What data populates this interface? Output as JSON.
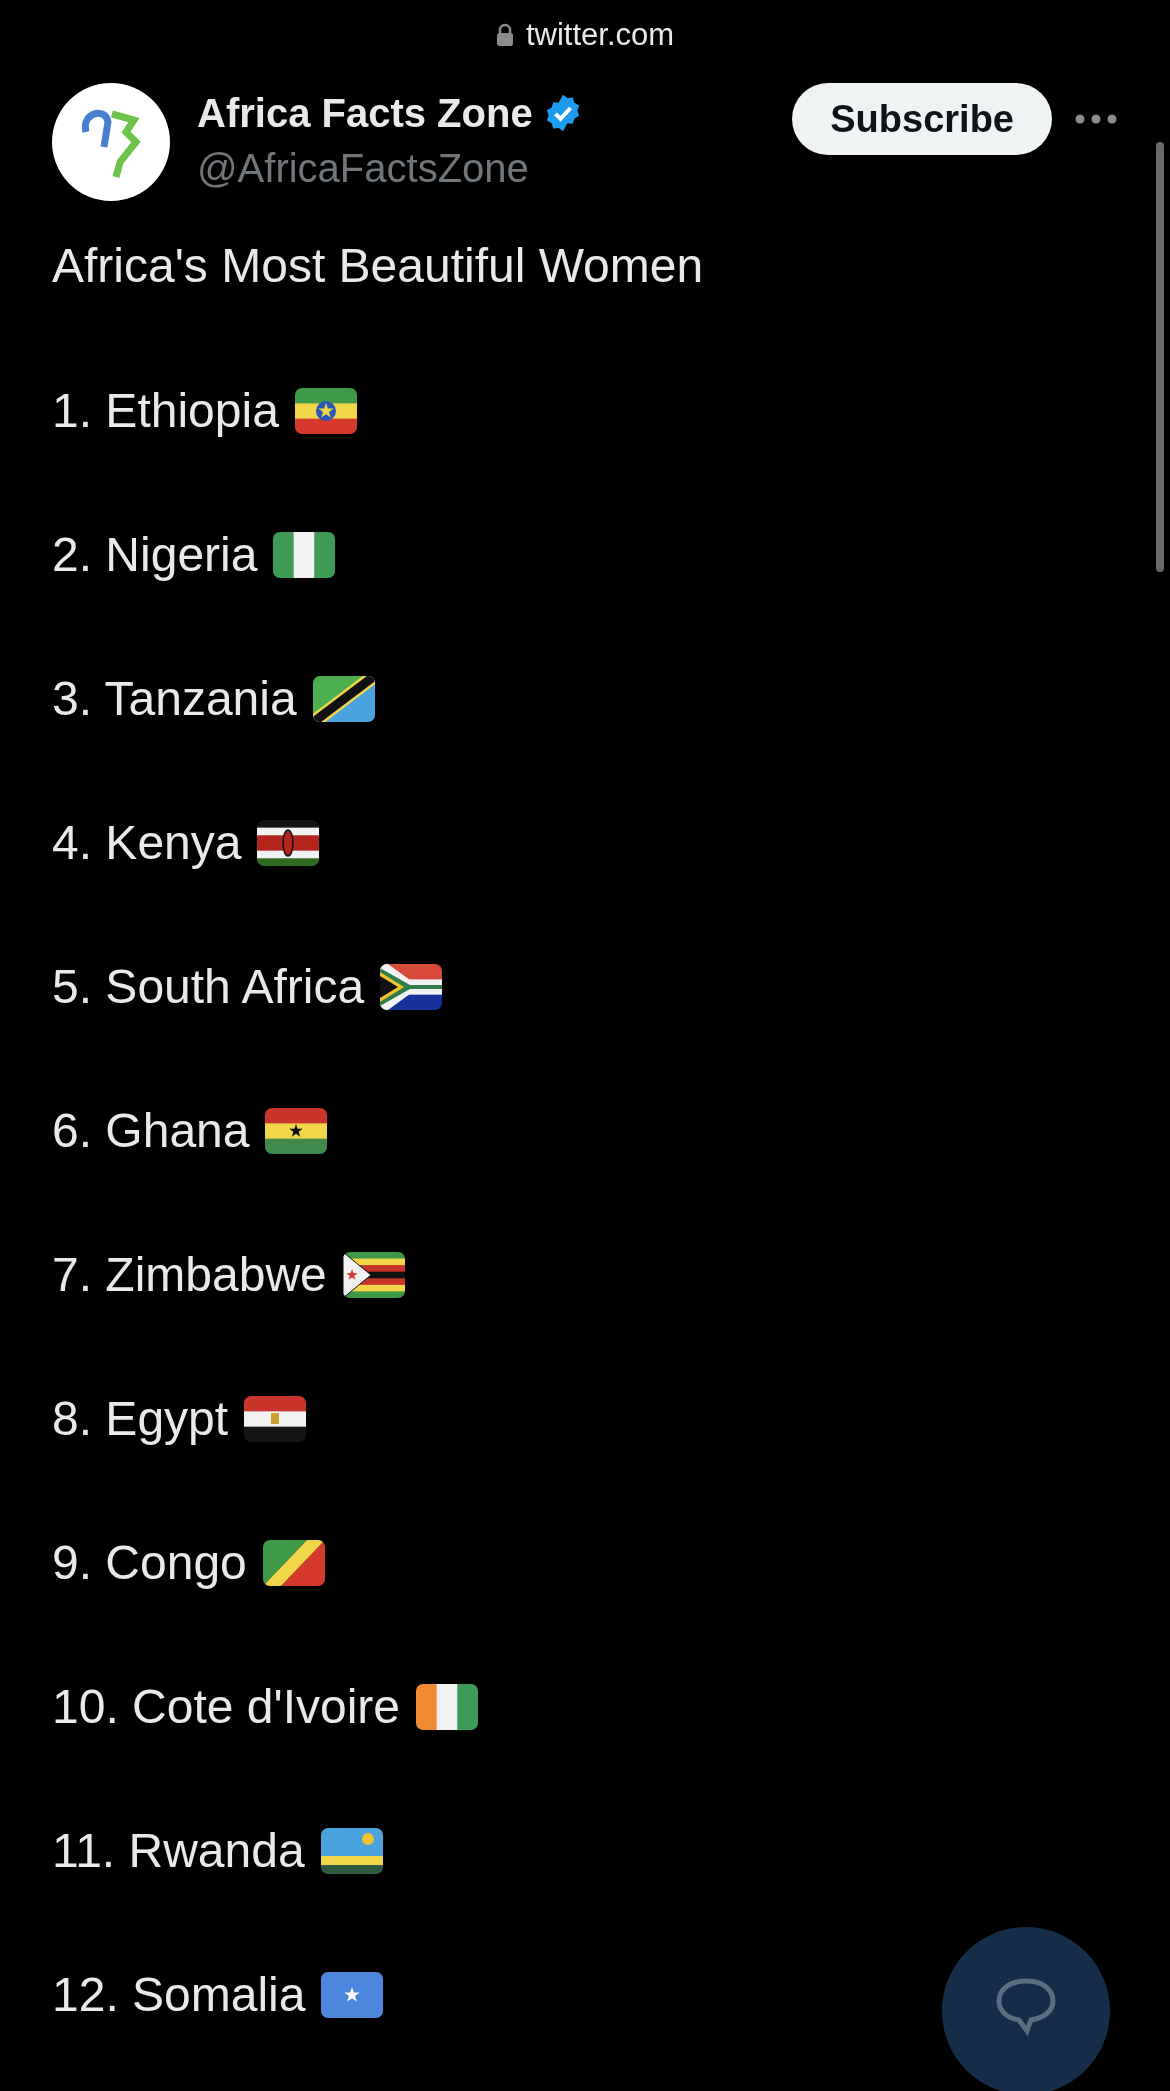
{
  "browser_bar": {
    "url": "twitter.com"
  },
  "tweet_header": {
    "name": "Africa Facts Zone",
    "verified": true,
    "handle": "@AfricaFactsZone",
    "subscribe_button": "Subscribe"
  },
  "tweet": {
    "title": "Africa's Most Beautiful Women",
    "items": [
      {
        "text": "1. Ethiopia"
      },
      {
        "text": "2. Nigeria"
      },
      {
        "text": "3. Tanzania"
      },
      {
        "text": "4. Kenya"
      },
      {
        "text": "5. South Africa"
      },
      {
        "text": "6. Ghana"
      },
      {
        "text": "7. Zimbabwe"
      },
      {
        "text": "8. Egypt"
      },
      {
        "text": "9. Congo"
      },
      {
        "text": "10. Cote d'Ivoire"
      },
      {
        "text": "11. Rwanda"
      },
      {
        "text": "12. Somalia"
      }
    ]
  }
}
